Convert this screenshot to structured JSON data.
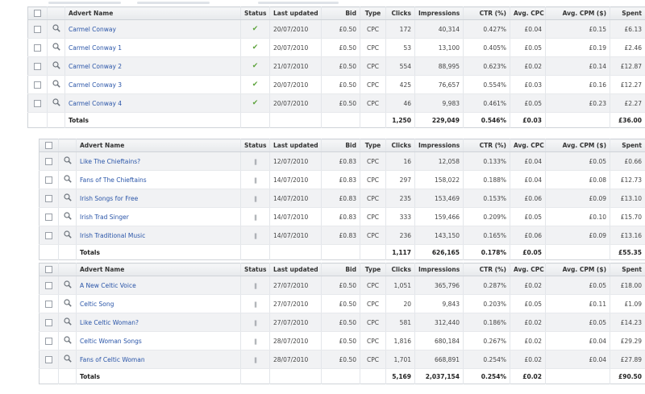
{
  "tables": [
    {
      "headers": {
        "name": "Advert Name",
        "status": "Status",
        "updated": "Last updated",
        "bid": "Bid",
        "type": "Type",
        "clicks": "Clicks",
        "impressions": "Impressions",
        "ctr": "CTR (%)",
        "cpc": "Avg. CPC",
        "cpm": "Avg. CPM ($)",
        "spent": "Spent"
      },
      "rows": [
        {
          "name": "Carmel Conway",
          "status": "active",
          "updated": "20/07/2010",
          "bid": "£0.50",
          "type": "CPC",
          "clicks": "172",
          "impressions": "40,314",
          "ctr": "0.427%",
          "cpc": "£0.04",
          "cpm": "£0.15",
          "spent": "£6.13"
        },
        {
          "name": "Carmel Conway 1",
          "status": "active",
          "updated": "20/07/2010",
          "bid": "£0.50",
          "type": "CPC",
          "clicks": "53",
          "impressions": "13,100",
          "ctr": "0.405%",
          "cpc": "£0.05",
          "cpm": "£0.19",
          "spent": "£2.46"
        },
        {
          "name": "Carmel Conway 2",
          "status": "active",
          "updated": "21/07/2010",
          "bid": "£0.50",
          "type": "CPC",
          "clicks": "554",
          "impressions": "88,995",
          "ctr": "0.623%",
          "cpc": "£0.02",
          "cpm": "£0.14",
          "spent": "£12.87"
        },
        {
          "name": "Carmel Conway 3",
          "status": "active",
          "updated": "20/07/2010",
          "bid": "£0.50",
          "type": "CPC",
          "clicks": "425",
          "impressions": "76,657",
          "ctr": "0.554%",
          "cpc": "£0.03",
          "cpm": "£0.16",
          "spent": "£12.27"
        },
        {
          "name": "Carmel Conway 4",
          "status": "active",
          "updated": "20/07/2010",
          "bid": "£0.50",
          "type": "CPC",
          "clicks": "46",
          "impressions": "9,983",
          "ctr": "0.461%",
          "cpc": "£0.05",
          "cpm": "£0.23",
          "spent": "£2.27"
        }
      ],
      "totals": {
        "label": "Totals",
        "clicks": "1,250",
        "impressions": "229,049",
        "ctr": "0.546%",
        "cpc": "£0.03",
        "spent": "£36.00"
      }
    },
    {
      "headers": {
        "name": "Advert Name",
        "status": "Status",
        "updated": "Last updated",
        "bid": "Bid",
        "type": "Type",
        "clicks": "Clicks",
        "impressions": "Impressions",
        "ctr": "CTR (%)",
        "cpc": "Avg. CPC",
        "cpm": "Avg. CPM ($)",
        "spent": "Spent"
      },
      "rows": [
        {
          "name": "Like The Chieftains?",
          "status": "paused",
          "updated": "12/07/2010",
          "bid": "£0.83",
          "type": "CPC",
          "clicks": "16",
          "impressions": "12,058",
          "ctr": "0.133%",
          "cpc": "£0.04",
          "cpm": "£0.05",
          "spent": "£0.66"
        },
        {
          "name": "Fans of The Chieftains",
          "status": "paused",
          "updated": "14/07/2010",
          "bid": "£0.83",
          "type": "CPC",
          "clicks": "297",
          "impressions": "158,022",
          "ctr": "0.188%",
          "cpc": "£0.04",
          "cpm": "£0.08",
          "spent": "£12.73"
        },
        {
          "name": "Irish Songs for Free",
          "status": "paused",
          "updated": "14/07/2010",
          "bid": "£0.83",
          "type": "CPC",
          "clicks": "235",
          "impressions": "153,469",
          "ctr": "0.153%",
          "cpc": "£0.06",
          "cpm": "£0.09",
          "spent": "£13.10"
        },
        {
          "name": "Irish Trad Singer",
          "status": "paused",
          "updated": "14/07/2010",
          "bid": "£0.83",
          "type": "CPC",
          "clicks": "333",
          "impressions": "159,466",
          "ctr": "0.209%",
          "cpc": "£0.05",
          "cpm": "£0.10",
          "spent": "£15.70"
        },
        {
          "name": "Irish Traditional Music",
          "status": "paused",
          "updated": "14/07/2010",
          "bid": "£0.83",
          "type": "CPC",
          "clicks": "236",
          "impressions": "143,150",
          "ctr": "0.165%",
          "cpc": "£0.06",
          "cpm": "£0.09",
          "spent": "£13.16"
        }
      ],
      "totals": {
        "label": "Totals",
        "clicks": "1,117",
        "impressions": "626,165",
        "ctr": "0.178%",
        "cpc": "£0.05",
        "spent": "£55.35"
      }
    },
    {
      "headers": {
        "name": "Advert Name",
        "status": "Status",
        "updated": "Last updated",
        "bid": "Bid",
        "type": "Type",
        "clicks": "Clicks",
        "impressions": "Impressions",
        "ctr": "CTR (%)",
        "cpc": "Avg. CPC",
        "cpm": "Avg. CPM ($)",
        "spent": "Spent"
      },
      "rows": [
        {
          "name": "A New Celtic Voice",
          "status": "paused",
          "updated": "27/07/2010",
          "bid": "£0.50",
          "type": "CPC",
          "clicks": "1,051",
          "impressions": "365,796",
          "ctr": "0.287%",
          "cpc": "£0.02",
          "cpm": "£0.05",
          "spent": "£18.00"
        },
        {
          "name": "Celtic Song",
          "status": "paused",
          "updated": "27/07/2010",
          "bid": "£0.50",
          "type": "CPC",
          "clicks": "20",
          "impressions": "9,843",
          "ctr": "0.203%",
          "cpc": "£0.05",
          "cpm": "£0.11",
          "spent": "£1.09"
        },
        {
          "name": "Like Celtic Woman?",
          "status": "paused",
          "updated": "27/07/2010",
          "bid": "£0.50",
          "type": "CPC",
          "clicks": "581",
          "impressions": "312,440",
          "ctr": "0.186%",
          "cpc": "£0.02",
          "cpm": "£0.05",
          "spent": "£14.23"
        },
        {
          "name": "Celtic Woman Songs",
          "status": "paused",
          "updated": "28/07/2010",
          "bid": "£0.50",
          "type": "CPC",
          "clicks": "1,816",
          "impressions": "680,184",
          "ctr": "0.267%",
          "cpc": "£0.02",
          "cpm": "£0.04",
          "spent": "£29.29"
        },
        {
          "name": "Fans of Celtic Woman",
          "status": "paused",
          "updated": "28/07/2010",
          "bid": "£0.50",
          "type": "CPC",
          "clicks": "1,701",
          "impressions": "668,891",
          "ctr": "0.254%",
          "cpc": "£0.02",
          "cpm": "£0.04",
          "spent": "£27.89"
        }
      ],
      "totals": {
        "label": "Totals",
        "clicks": "5,169",
        "impressions": "2,037,154",
        "ctr": "0.254%",
        "cpc": "£0.02",
        "spent": "£90.50"
      }
    }
  ]
}
